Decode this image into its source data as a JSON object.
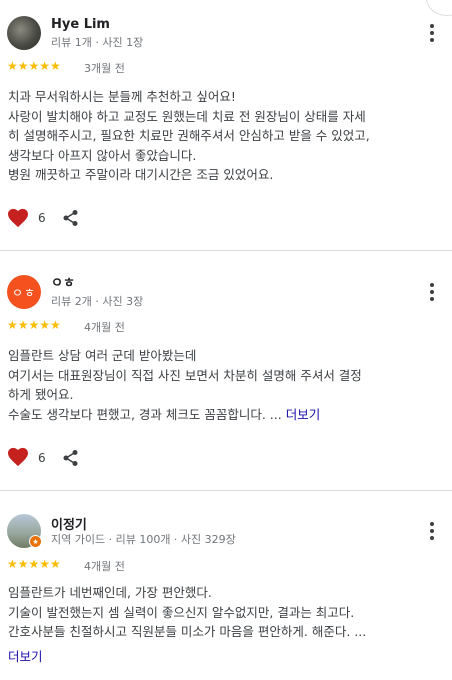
{
  "reviews": [
    {
      "name": "Hye Lim",
      "meta": "리뷰 1개 · 사진 1장",
      "stars": "★★★★★",
      "ago": "3개월 전",
      "lines": [
        "치과 무서워하시는 분들께 추천하고 싶어요!",
        "사랑이 발치해야 하고 교정도 원했는데 치료 전 원장님이 상태를 자세",
        "히 설명해주시고, 필요한 치료만 권해주셔서 안심하고 받을 수 있었고,",
        "생각보다 아프지 않아서 좋았습니다.",
        "병원 깨끗하고 주말이라 대기시간은 조금 있었어요."
      ],
      "likes": "6",
      "avatar_icon": "profile-photo"
    },
    {
      "name": "ㅇㅎ",
      "avatar_letters": "ㅇㅎ",
      "meta": "리뷰 2개 · 사진 3장",
      "stars": "★★★★★",
      "ago": "4개월 전",
      "lines": [
        "임플란트 상담 여러 군데 받아봤는데",
        "여기서는 대표원장님이 직접 사진 보면서 차분히 설명해 주셔서 결정",
        "하게 됐어요.",
        "수술도 생각보다 편했고, 경과 체크도 꼼꼼합니다. ..."
      ],
      "more": "더보기",
      "likes": "6"
    },
    {
      "name": "이정기",
      "meta": "지역 가이드 · 리뷰 100개 · 사진 329장",
      "stars": "★★★★★",
      "ago": "4개월 전",
      "lines": [
        "임플란트가 네번째인데, 가장 편안했다.",
        "기술이 발전했는지 셈 실력이 좋으신지 알수없지만, 결과는 최고다.",
        "간호사분들 친절하시고 직원분들 미소가 마음을 편안하게. 해준다. ..."
      ],
      "more": "더보기",
      "avatar_icon": "profile-photo",
      "badge_icon": "local-guide-star-icon"
    }
  ],
  "colors": {
    "star": "#fbbc04",
    "heart": "#c5221f",
    "link": "#1a0dab",
    "avatar_orange": "#f4511e"
  }
}
